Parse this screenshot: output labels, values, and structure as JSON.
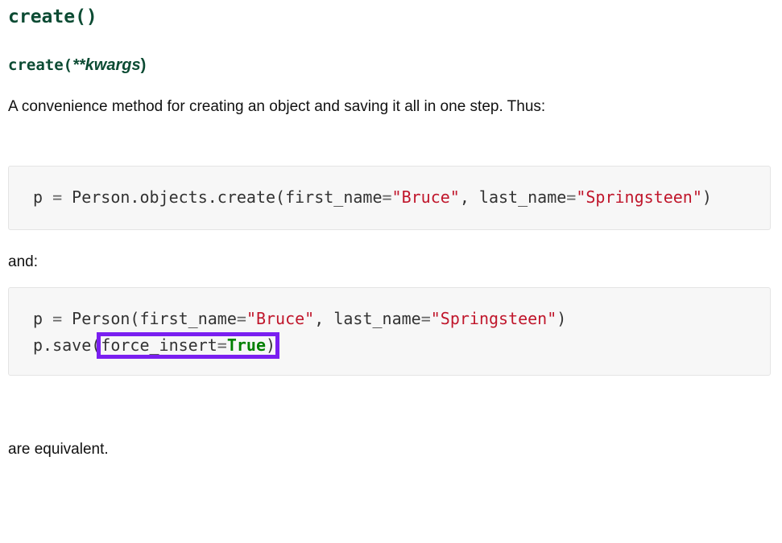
{
  "heading": {
    "title": "create()",
    "signature_name": "create(",
    "signature_params": "**kwargs",
    "signature_close": ")"
  },
  "paragraphs": {
    "description": "A convenience method for creating an object and saving it all in one step. Thus:",
    "and": "and:",
    "equivalent": "are equivalent."
  },
  "code_block_1": {
    "line1": {
      "prefix": "p ",
      "eq1": "=",
      "call": " Person.objects.create(first_name",
      "eq2": "=",
      "str1": "\"Bruce\"",
      "mid": ", last_name",
      "eq3": "=",
      "str2": "\"Springsteen\"",
      "close": ")"
    }
  },
  "code_block_2": {
    "line1": {
      "prefix": "p ",
      "eq1": "=",
      "call": " Person(first_name",
      "eq2": "=",
      "str1": "\"Bruce\"",
      "mid": ", last_name",
      "eq3": "=",
      "str2": "\"Springsteen\"",
      "close": ")"
    },
    "line2": {
      "call": "p.save(",
      "arg": "force_insert",
      "eq": "=",
      "value": "True",
      "close": ")"
    }
  },
  "colors": {
    "heading": "#0c4b33",
    "string": "#c0162b",
    "keyword": "#008000",
    "highlight_box": "#7a1ff0",
    "code_background": "#f7f7f7"
  }
}
